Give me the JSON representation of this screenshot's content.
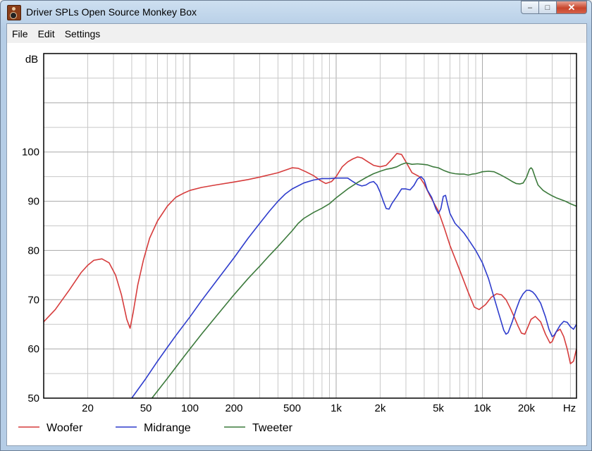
{
  "window": {
    "title": "Driver SPLs Open Source Monkey Box",
    "icon": "speaker-icon",
    "caption_buttons": [
      "minimize",
      "maximize",
      "close"
    ]
  },
  "menu": [
    "File",
    "Edit",
    "Settings"
  ],
  "chart_data": {
    "type": "line",
    "xscale": "log",
    "xlim": [
      10,
      20000
    ],
    "ylim": [
      50,
      120
    ],
    "ylabel": "dB",
    "xlabel": "Hz",
    "grid": true,
    "legend_position": "bottom",
    "x_ticks": [
      {
        "value": 20,
        "label": "20"
      },
      {
        "value": 50,
        "label": "50"
      },
      {
        "value": 100,
        "label": "100"
      },
      {
        "value": 200,
        "label": "200"
      },
      {
        "value": 500,
        "label": "500"
      },
      {
        "value": 1000,
        "label": "1k"
      },
      {
        "value": 2000,
        "label": "2k"
      },
      {
        "value": 5000,
        "label": "5k"
      },
      {
        "value": 10000,
        "label": "10k"
      },
      {
        "value": 20000,
        "label": "20k"
      }
    ],
    "y_ticks": [
      {
        "value": 100,
        "label": "100"
      },
      {
        "value": 90,
        "label": "90"
      },
      {
        "value": 80,
        "label": "80"
      },
      {
        "value": 70,
        "label": "70"
      },
      {
        "value": 60,
        "label": "60"
      },
      {
        "value": 50,
        "label": "50"
      }
    ],
    "series": [
      {
        "name": "Woofer",
        "color": "#d63c3c",
        "points": [
          [
            10,
            65.5
          ],
          [
            12,
            68
          ],
          [
            15,
            72
          ],
          [
            18,
            75.5
          ],
          [
            20,
            77
          ],
          [
            22,
            78
          ],
          [
            25,
            78.3
          ],
          [
            28,
            77.5
          ],
          [
            31,
            75
          ],
          [
            34,
            71
          ],
          [
            37,
            66
          ],
          [
            39,
            64.2
          ],
          [
            41,
            67.5
          ],
          [
            44,
            73
          ],
          [
            48,
            78
          ],
          [
            53,
            82.5
          ],
          [
            60,
            86
          ],
          [
            70,
            89
          ],
          [
            80,
            90.8
          ],
          [
            90,
            91.6
          ],
          [
            100,
            92.2
          ],
          [
            120,
            92.8
          ],
          [
            150,
            93.3
          ],
          [
            200,
            93.9
          ],
          [
            250,
            94.4
          ],
          [
            300,
            94.9
          ],
          [
            400,
            95.8
          ],
          [
            500,
            96.8
          ],
          [
            550,
            96.7
          ],
          [
            620,
            96
          ],
          [
            700,
            95.2
          ],
          [
            780,
            94.2
          ],
          [
            850,
            93.6
          ],
          [
            930,
            94
          ],
          [
            1000,
            95
          ],
          [
            1100,
            97
          ],
          [
            1200,
            98
          ],
          [
            1300,
            98.6
          ],
          [
            1400,
            99
          ],
          [
            1500,
            98.8
          ],
          [
            1650,
            98
          ],
          [
            1800,
            97.3
          ],
          [
            2000,
            97
          ],
          [
            2200,
            97.3
          ],
          [
            2400,
            98.5
          ],
          [
            2600,
            99.7
          ],
          [
            2800,
            99.5
          ],
          [
            3000,
            98
          ],
          [
            3300,
            95.8
          ],
          [
            3700,
            95
          ],
          [
            4000,
            93.5
          ],
          [
            4400,
            91
          ],
          [
            5000,
            88
          ],
          [
            5500,
            84.5
          ],
          [
            6000,
            81
          ],
          [
            7000,
            76
          ],
          [
            8000,
            71.5
          ],
          [
            8800,
            68.5
          ],
          [
            9500,
            68
          ],
          [
            10500,
            69
          ],
          [
            11500,
            70.5
          ],
          [
            12500,
            71.2
          ],
          [
            13500,
            71
          ],
          [
            14500,
            70
          ],
          [
            15500,
            68.3
          ],
          [
            16500,
            66.5
          ],
          [
            17500,
            64.7
          ],
          [
            18500,
            63.2
          ],
          [
            19500,
            63
          ],
          [
            20500,
            64.5
          ],
          [
            21500,
            66
          ],
          [
            23000,
            66.6
          ],
          [
            25000,
            65.5
          ],
          [
            27000,
            63
          ],
          [
            29000,
            61.2
          ],
          [
            30000,
            61.5
          ],
          [
            32000,
            63.5
          ],
          [
            34000,
            64
          ],
          [
            36000,
            62.5
          ],
          [
            38000,
            60
          ],
          [
            40000,
            57
          ],
          [
            42000,
            57.5
          ],
          [
            44000,
            60
          ]
        ]
      },
      {
        "name": "Midrange",
        "color": "#2e3ccc",
        "points": [
          [
            40,
            50
          ],
          [
            50,
            54
          ],
          [
            60,
            57.5
          ],
          [
            70,
            60.3
          ],
          [
            80,
            62.7
          ],
          [
            100,
            66.5
          ],
          [
            120,
            69.8
          ],
          [
            150,
            73.6
          ],
          [
            200,
            78.5
          ],
          [
            250,
            82.5
          ],
          [
            300,
            85.5
          ],
          [
            350,
            88
          ],
          [
            400,
            90
          ],
          [
            450,
            91.5
          ],
          [
            500,
            92.5
          ],
          [
            600,
            93.7
          ],
          [
            700,
            94.3
          ],
          [
            800,
            94.6
          ],
          [
            900,
            94.6
          ],
          [
            1000,
            94.7
          ],
          [
            1100,
            94.7
          ],
          [
            1200,
            94.7
          ],
          [
            1300,
            94
          ],
          [
            1400,
            93.4
          ],
          [
            1500,
            93.1
          ],
          [
            1600,
            93.3
          ],
          [
            1700,
            93.8
          ],
          [
            1800,
            94
          ],
          [
            1900,
            93.3
          ],
          [
            2000,
            91.8
          ],
          [
            2100,
            90
          ],
          [
            2200,
            88.5
          ],
          [
            2300,
            88.4
          ],
          [
            2400,
            89.5
          ],
          [
            2600,
            91
          ],
          [
            2800,
            92.5
          ],
          [
            3000,
            92.5
          ],
          [
            3200,
            92.3
          ],
          [
            3400,
            93.2
          ],
          [
            3600,
            94.5
          ],
          [
            3800,
            95
          ],
          [
            4000,
            94.3
          ],
          [
            4200,
            92.3
          ],
          [
            4500,
            90.8
          ],
          [
            4800,
            88.5
          ],
          [
            5000,
            87.5
          ],
          [
            5200,
            88.5
          ],
          [
            5400,
            91
          ],
          [
            5600,
            91.2
          ],
          [
            5800,
            89.2
          ],
          [
            6000,
            87.5
          ],
          [
            6500,
            85.5
          ],
          [
            7000,
            84.5
          ],
          [
            7500,
            83.5
          ],
          [
            8000,
            82.3
          ],
          [
            9000,
            80
          ],
          [
            10000,
            77.5
          ],
          [
            11000,
            74.3
          ],
          [
            12000,
            70.5
          ],
          [
            13000,
            67
          ],
          [
            14000,
            63.8
          ],
          [
            14500,
            63
          ],
          [
            15000,
            63.3
          ],
          [
            16000,
            65.5
          ],
          [
            17000,
            68
          ],
          [
            18000,
            70
          ],
          [
            19000,
            71.2
          ],
          [
            20000,
            71.9
          ],
          [
            21000,
            71.9
          ],
          [
            22000,
            71.6
          ],
          [
            23000,
            71
          ],
          [
            25000,
            69.3
          ],
          [
            27000,
            66.5
          ],
          [
            28500,
            64
          ],
          [
            30000,
            62.5
          ],
          [
            31000,
            62.8
          ],
          [
            32000,
            63.5
          ],
          [
            34000,
            64.8
          ],
          [
            36000,
            65.6
          ],
          [
            38000,
            65.4
          ],
          [
            40000,
            64.5
          ],
          [
            42000,
            64
          ],
          [
            44000,
            65
          ]
        ]
      },
      {
        "name": "Tweeter",
        "color": "#3c7a3c",
        "points": [
          [
            55,
            50
          ],
          [
            70,
            54
          ],
          [
            85,
            57.3
          ],
          [
            100,
            60
          ],
          [
            120,
            63
          ],
          [
            150,
            66.5
          ],
          [
            200,
            71
          ],
          [
            250,
            74.3
          ],
          [
            300,
            76.8
          ],
          [
            350,
            79
          ],
          [
            400,
            80.8
          ],
          [
            450,
            82.5
          ],
          [
            500,
            84
          ],
          [
            550,
            85.5
          ],
          [
            600,
            86.5
          ],
          [
            700,
            87.7
          ],
          [
            800,
            88.6
          ],
          [
            900,
            89.5
          ],
          [
            1000,
            90.7
          ],
          [
            1200,
            92.5
          ],
          [
            1400,
            93.8
          ],
          [
            1600,
            94.8
          ],
          [
            1800,
            95.6
          ],
          [
            2000,
            96.1
          ],
          [
            2200,
            96.5
          ],
          [
            2400,
            96.7
          ],
          [
            2600,
            97
          ],
          [
            2800,
            97.5
          ],
          [
            3000,
            97.8
          ],
          [
            3300,
            97.5
          ],
          [
            3600,
            97.6
          ],
          [
            3900,
            97.5
          ],
          [
            4200,
            97.4
          ],
          [
            4600,
            97
          ],
          [
            5000,
            96.8
          ],
          [
            5500,
            96.2
          ],
          [
            6000,
            95.8
          ],
          [
            6500,
            95.6
          ],
          [
            7000,
            95.5
          ],
          [
            7500,
            95.5
          ],
          [
            8000,
            95.3
          ],
          [
            8500,
            95.5
          ],
          [
            9000,
            95.6
          ],
          [
            9500,
            95.8
          ],
          [
            10000,
            96
          ],
          [
            11000,
            96.1
          ],
          [
            12000,
            96
          ],
          [
            13000,
            95.5
          ],
          [
            14000,
            95
          ],
          [
            15000,
            94.5
          ],
          [
            16000,
            94
          ],
          [
            17000,
            93.6
          ],
          [
            18000,
            93.5
          ],
          [
            19000,
            93.7
          ],
          [
            20000,
            94.8
          ],
          [
            21000,
            96.5
          ],
          [
            21500,
            96.8
          ],
          [
            22000,
            96.5
          ],
          [
            23000,
            94.8
          ],
          [
            24000,
            93.3
          ],
          [
            26000,
            92.2
          ],
          [
            28000,
            91.6
          ],
          [
            30000,
            91.1
          ],
          [
            32000,
            90.7
          ],
          [
            34000,
            90.4
          ],
          [
            37000,
            90
          ],
          [
            40000,
            89.5
          ],
          [
            44000,
            89
          ]
        ]
      }
    ]
  }
}
